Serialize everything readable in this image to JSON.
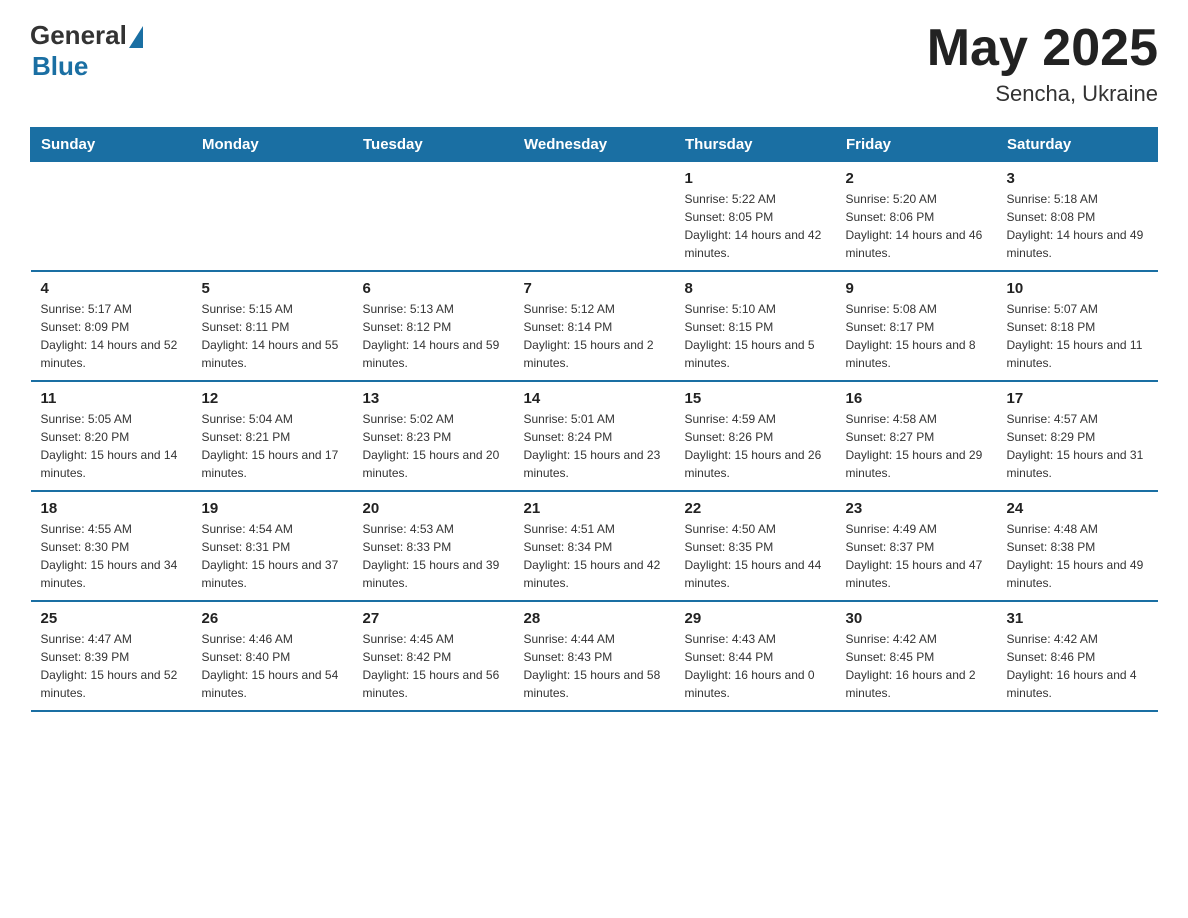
{
  "header": {
    "logo_general": "General",
    "logo_blue": "Blue",
    "month_title": "May 2025",
    "location": "Sencha, Ukraine"
  },
  "weekdays": [
    "Sunday",
    "Monday",
    "Tuesday",
    "Wednesday",
    "Thursday",
    "Friday",
    "Saturday"
  ],
  "weeks": [
    [
      {
        "day": "",
        "info": ""
      },
      {
        "day": "",
        "info": ""
      },
      {
        "day": "",
        "info": ""
      },
      {
        "day": "",
        "info": ""
      },
      {
        "day": "1",
        "info": "Sunrise: 5:22 AM\nSunset: 8:05 PM\nDaylight: 14 hours and 42 minutes."
      },
      {
        "day": "2",
        "info": "Sunrise: 5:20 AM\nSunset: 8:06 PM\nDaylight: 14 hours and 46 minutes."
      },
      {
        "day": "3",
        "info": "Sunrise: 5:18 AM\nSunset: 8:08 PM\nDaylight: 14 hours and 49 minutes."
      }
    ],
    [
      {
        "day": "4",
        "info": "Sunrise: 5:17 AM\nSunset: 8:09 PM\nDaylight: 14 hours and 52 minutes."
      },
      {
        "day": "5",
        "info": "Sunrise: 5:15 AM\nSunset: 8:11 PM\nDaylight: 14 hours and 55 minutes."
      },
      {
        "day": "6",
        "info": "Sunrise: 5:13 AM\nSunset: 8:12 PM\nDaylight: 14 hours and 59 minutes."
      },
      {
        "day": "7",
        "info": "Sunrise: 5:12 AM\nSunset: 8:14 PM\nDaylight: 15 hours and 2 minutes."
      },
      {
        "day": "8",
        "info": "Sunrise: 5:10 AM\nSunset: 8:15 PM\nDaylight: 15 hours and 5 minutes."
      },
      {
        "day": "9",
        "info": "Sunrise: 5:08 AM\nSunset: 8:17 PM\nDaylight: 15 hours and 8 minutes."
      },
      {
        "day": "10",
        "info": "Sunrise: 5:07 AM\nSunset: 8:18 PM\nDaylight: 15 hours and 11 minutes."
      }
    ],
    [
      {
        "day": "11",
        "info": "Sunrise: 5:05 AM\nSunset: 8:20 PM\nDaylight: 15 hours and 14 minutes."
      },
      {
        "day": "12",
        "info": "Sunrise: 5:04 AM\nSunset: 8:21 PM\nDaylight: 15 hours and 17 minutes."
      },
      {
        "day": "13",
        "info": "Sunrise: 5:02 AM\nSunset: 8:23 PM\nDaylight: 15 hours and 20 minutes."
      },
      {
        "day": "14",
        "info": "Sunrise: 5:01 AM\nSunset: 8:24 PM\nDaylight: 15 hours and 23 minutes."
      },
      {
        "day": "15",
        "info": "Sunrise: 4:59 AM\nSunset: 8:26 PM\nDaylight: 15 hours and 26 minutes."
      },
      {
        "day": "16",
        "info": "Sunrise: 4:58 AM\nSunset: 8:27 PM\nDaylight: 15 hours and 29 minutes."
      },
      {
        "day": "17",
        "info": "Sunrise: 4:57 AM\nSunset: 8:29 PM\nDaylight: 15 hours and 31 minutes."
      }
    ],
    [
      {
        "day": "18",
        "info": "Sunrise: 4:55 AM\nSunset: 8:30 PM\nDaylight: 15 hours and 34 minutes."
      },
      {
        "day": "19",
        "info": "Sunrise: 4:54 AM\nSunset: 8:31 PM\nDaylight: 15 hours and 37 minutes."
      },
      {
        "day": "20",
        "info": "Sunrise: 4:53 AM\nSunset: 8:33 PM\nDaylight: 15 hours and 39 minutes."
      },
      {
        "day": "21",
        "info": "Sunrise: 4:51 AM\nSunset: 8:34 PM\nDaylight: 15 hours and 42 minutes."
      },
      {
        "day": "22",
        "info": "Sunrise: 4:50 AM\nSunset: 8:35 PM\nDaylight: 15 hours and 44 minutes."
      },
      {
        "day": "23",
        "info": "Sunrise: 4:49 AM\nSunset: 8:37 PM\nDaylight: 15 hours and 47 minutes."
      },
      {
        "day": "24",
        "info": "Sunrise: 4:48 AM\nSunset: 8:38 PM\nDaylight: 15 hours and 49 minutes."
      }
    ],
    [
      {
        "day": "25",
        "info": "Sunrise: 4:47 AM\nSunset: 8:39 PM\nDaylight: 15 hours and 52 minutes."
      },
      {
        "day": "26",
        "info": "Sunrise: 4:46 AM\nSunset: 8:40 PM\nDaylight: 15 hours and 54 minutes."
      },
      {
        "day": "27",
        "info": "Sunrise: 4:45 AM\nSunset: 8:42 PM\nDaylight: 15 hours and 56 minutes."
      },
      {
        "day": "28",
        "info": "Sunrise: 4:44 AM\nSunset: 8:43 PM\nDaylight: 15 hours and 58 minutes."
      },
      {
        "day": "29",
        "info": "Sunrise: 4:43 AM\nSunset: 8:44 PM\nDaylight: 16 hours and 0 minutes."
      },
      {
        "day": "30",
        "info": "Sunrise: 4:42 AM\nSunset: 8:45 PM\nDaylight: 16 hours and 2 minutes."
      },
      {
        "day": "31",
        "info": "Sunrise: 4:42 AM\nSunset: 8:46 PM\nDaylight: 16 hours and 4 minutes."
      }
    ]
  ]
}
